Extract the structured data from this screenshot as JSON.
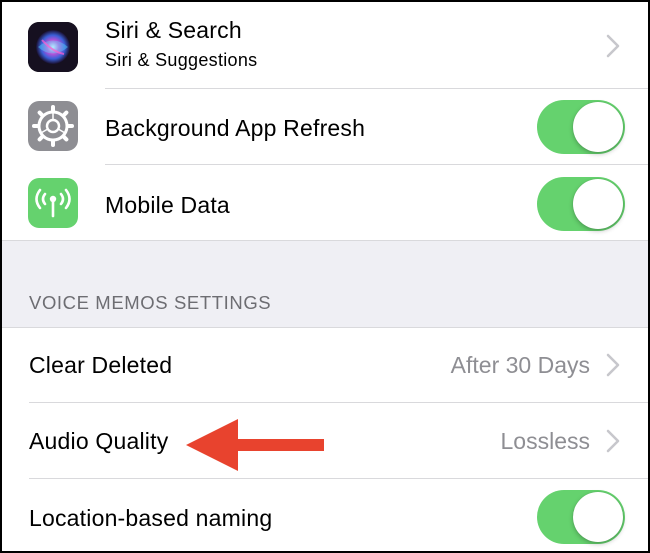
{
  "rows_top": [
    {
      "title": "Siri & Search",
      "subtitle": "Siri & Suggestions",
      "icon": "siri-icon",
      "accessory": "chevron"
    },
    {
      "title": "Background App Refresh",
      "icon": "gear-icon",
      "accessory": "toggle",
      "on": true
    },
    {
      "title": "Mobile Data",
      "icon": "antenna-icon",
      "accessory": "toggle",
      "on": true
    }
  ],
  "section": {
    "header": "VOICE MEMOS SETTINGS"
  },
  "rows_bottom": [
    {
      "title": "Clear Deleted",
      "value": "After 30 Days",
      "accessory": "chevron"
    },
    {
      "title": "Audio Quality",
      "value": "Lossless",
      "accessory": "chevron"
    },
    {
      "title": "Location-based naming",
      "accessory": "toggle",
      "on": true
    }
  ],
  "colors": {
    "toggle_on": "#65d26e",
    "annotation_arrow": "#e8432e",
    "grouped_background": "#efeff4",
    "secondary_text": "#8e8e93",
    "mobile_data_icon": "#65d26e",
    "settings_icon": "#8e8e93"
  },
  "annotation": {
    "type": "arrow",
    "points_to": "Audio Quality"
  }
}
